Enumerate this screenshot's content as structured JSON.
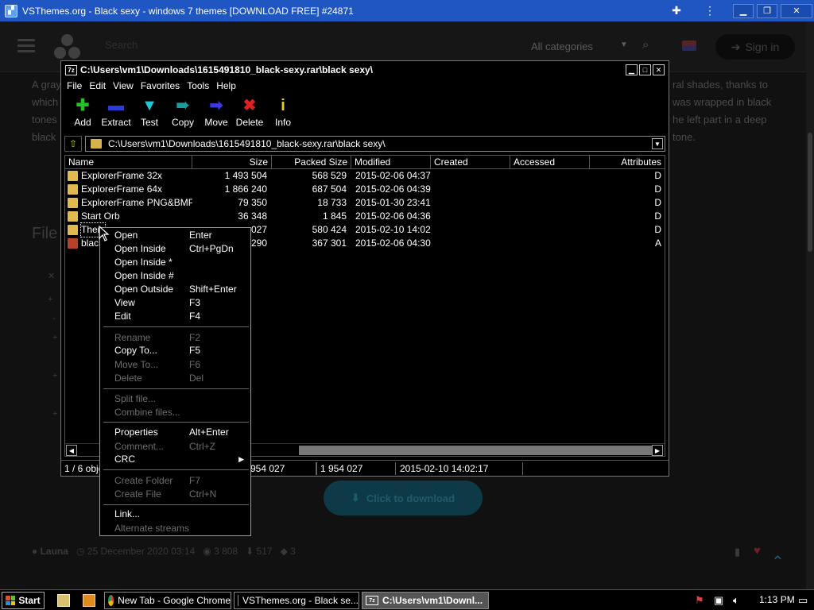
{
  "browser": {
    "title": "VSThemes.org - Black sexy - windows 7 themes [DOWNLOAD FREE] #24871",
    "minimize": "▁",
    "maximize": "❐",
    "close": "✕"
  },
  "site": {
    "search_placeholder": "Search",
    "categories": "All categories",
    "signin": "Sign in",
    "text_lines": [
      "A gray",
      "which",
      "tones",
      "black"
    ],
    "text_lines_right": [
      "ral shades, thanks to",
      "was wrapped in black",
      "he left part in a deep",
      "tone."
    ],
    "files_heading": "File",
    "download_label": "Click to download",
    "author": "Launa",
    "date": "25 December 2020 03:14",
    "views": "3 808",
    "downloads": "517",
    "comments": "3"
  },
  "sevenzip": {
    "title": "C:\\Users\\vm1\\Downloads\\1615491810_black-sexy.rar\\black sexy\\",
    "menu": [
      "File",
      "Edit",
      "View",
      "Favorites",
      "Tools",
      "Help"
    ],
    "toolbar": [
      {
        "label": "Add",
        "icon": "add-icon",
        "glyph": "✚",
        "color": "#22c322"
      },
      {
        "label": "Extract",
        "icon": "extract-icon",
        "glyph": "▬",
        "color": "#2a3ad8"
      },
      {
        "label": "Test",
        "icon": "test-icon",
        "glyph": "▼",
        "color": "#1fc8d8"
      },
      {
        "label": "Copy",
        "icon": "copy-icon",
        "glyph": "➠",
        "color": "#1a9fa0"
      },
      {
        "label": "Move",
        "icon": "move-icon",
        "glyph": "➡",
        "color": "#3a3ae0"
      },
      {
        "label": "Delete",
        "icon": "delete-icon",
        "glyph": "✖",
        "color": "#e02020"
      },
      {
        "label": "Info",
        "icon": "info-icon",
        "glyph": "i",
        "color": "#e8d020"
      }
    ],
    "address": "C:\\Users\\vm1\\Downloads\\1615491810_black-sexy.rar\\black sexy\\",
    "columns": [
      "Name",
      "Size",
      "Packed Size",
      "Modified",
      "Created",
      "Accessed",
      "Attributes"
    ],
    "rows": [
      {
        "name": "ExplorerFrame 32x",
        "size": "1 493 504",
        "packed": "568 529",
        "modified": "2015-02-06 04:37",
        "attr": "D",
        "type": "folder"
      },
      {
        "name": "ExplorerFrame 64x",
        "size": "1 866 240",
        "packed": "687 504",
        "modified": "2015-02-06 04:39",
        "attr": "D",
        "type": "folder"
      },
      {
        "name": "ExplorerFrame PNG&BMP ...",
        "size": "79 350",
        "packed": "18 733",
        "modified": "2015-01-30 23:41",
        "attr": "D",
        "type": "folder"
      },
      {
        "name": "Start Orb",
        "size": "36 348",
        "packed": "1 845",
        "modified": "2015-02-06 04:36",
        "attr": "D",
        "type": "folder"
      },
      {
        "name": "Ther",
        "size": "027",
        "packed": "580 424",
        "modified": "2015-02-10 14:02",
        "attr": "D",
        "type": "folder"
      },
      {
        "name": "black",
        "size": "290",
        "packed": "367 301",
        "modified": "2015-02-06 04:30",
        "attr": "A",
        "type": "file"
      }
    ],
    "status": {
      "selection": "1 / 6 obje",
      "size": "954 027",
      "packed": "1 954 027",
      "modified": "2015-02-10 14:02:17"
    }
  },
  "context_menu": [
    {
      "label": "Open",
      "shortcut": "Enter",
      "disabled": false
    },
    {
      "label": "Open Inside",
      "shortcut": "Ctrl+PgDn",
      "disabled": false
    },
    {
      "label": "Open Inside *",
      "shortcut": "",
      "disabled": false
    },
    {
      "label": "Open Inside #",
      "shortcut": "",
      "disabled": false
    },
    {
      "label": "Open Outside",
      "shortcut": "Shift+Enter",
      "disabled": false
    },
    {
      "label": "View",
      "shortcut": "F3",
      "disabled": false
    },
    {
      "label": "Edit",
      "shortcut": "F4",
      "disabled": false
    },
    {
      "label": "Rename",
      "shortcut": "F2",
      "disabled": true
    },
    {
      "label": "Copy To...",
      "shortcut": "F5",
      "disabled": false
    },
    {
      "label": "Move To...",
      "shortcut": "F6",
      "disabled": true
    },
    {
      "label": "Delete",
      "shortcut": "Del",
      "disabled": true
    },
    {
      "label": "Split file...",
      "shortcut": "",
      "disabled": true
    },
    {
      "label": "Combine files...",
      "shortcut": "",
      "disabled": true
    },
    {
      "label": "Properties",
      "shortcut": "Alt+Enter",
      "disabled": false
    },
    {
      "label": "Comment...",
      "shortcut": "Ctrl+Z",
      "disabled": true
    },
    {
      "label": "CRC",
      "shortcut": "",
      "disabled": false,
      "submenu": true
    },
    {
      "label": "Create Folder",
      "shortcut": "F7",
      "disabled": true
    },
    {
      "label": "Create File",
      "shortcut": "Ctrl+N",
      "disabled": true
    },
    {
      "label": "Link...",
      "shortcut": "",
      "disabled": false
    },
    {
      "label": "Alternate streams",
      "shortcut": "",
      "disabled": true
    }
  ],
  "taskbar": {
    "start": "Start",
    "tasks": [
      {
        "label": "New Tab - Google Chrome",
        "icon": "chrome-icon"
      },
      {
        "label": "VSThemes.org - Black se...",
        "icon": "vsthemes-icon"
      },
      {
        "label": "C:\\Users\\vm1\\Downl...",
        "icon": "7zip-icon",
        "active": true
      }
    ],
    "clock": "1:13 PM"
  }
}
